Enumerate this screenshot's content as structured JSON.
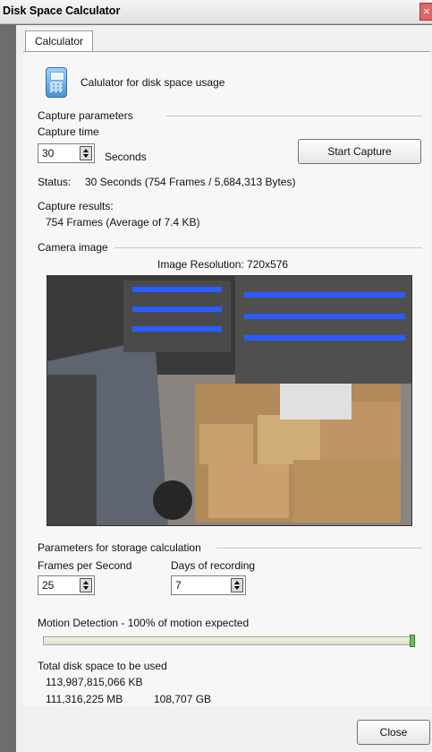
{
  "window": {
    "title": "Disk Space Calculator"
  },
  "tabs": [
    {
      "label": "Calculator"
    }
  ],
  "header": {
    "description": "Calulator for disk space usage",
    "icon": "calculator-icon"
  },
  "capture": {
    "section_label": "Capture parameters",
    "time_label": "Capture time",
    "time_value": "30",
    "unit_label": "Seconds",
    "start_button": "Start Capture",
    "status_label": "Status:",
    "status_text": "30 Seconds (754 Frames / 5,684,313 Bytes)",
    "results_label": "Capture results:",
    "results_text": "754 Frames (Average of 7.4 KB)"
  },
  "camera": {
    "section_label": "Camera image",
    "resolution_text": "Image Resolution: 720x576"
  },
  "storage": {
    "section_label": "Parameters for storage calculation",
    "fps_label": "Frames per Second",
    "fps_value": "25",
    "days_label": "Days of recording",
    "days_value": "7",
    "motion_label": "Motion Detection - 100% of motion expected",
    "motion_percent": 100,
    "total_label": "Total disk space to be used",
    "kb_text": "113,987,815,066 KB",
    "mb_text": "111,316,225 MB",
    "gb_text": "108,707 GB"
  },
  "footer": {
    "close_button": "Close"
  },
  "colors": {
    "accent_red": "#c7262c",
    "slider_green": "#6dbf5d",
    "window_bg": "#f0f0f0"
  }
}
